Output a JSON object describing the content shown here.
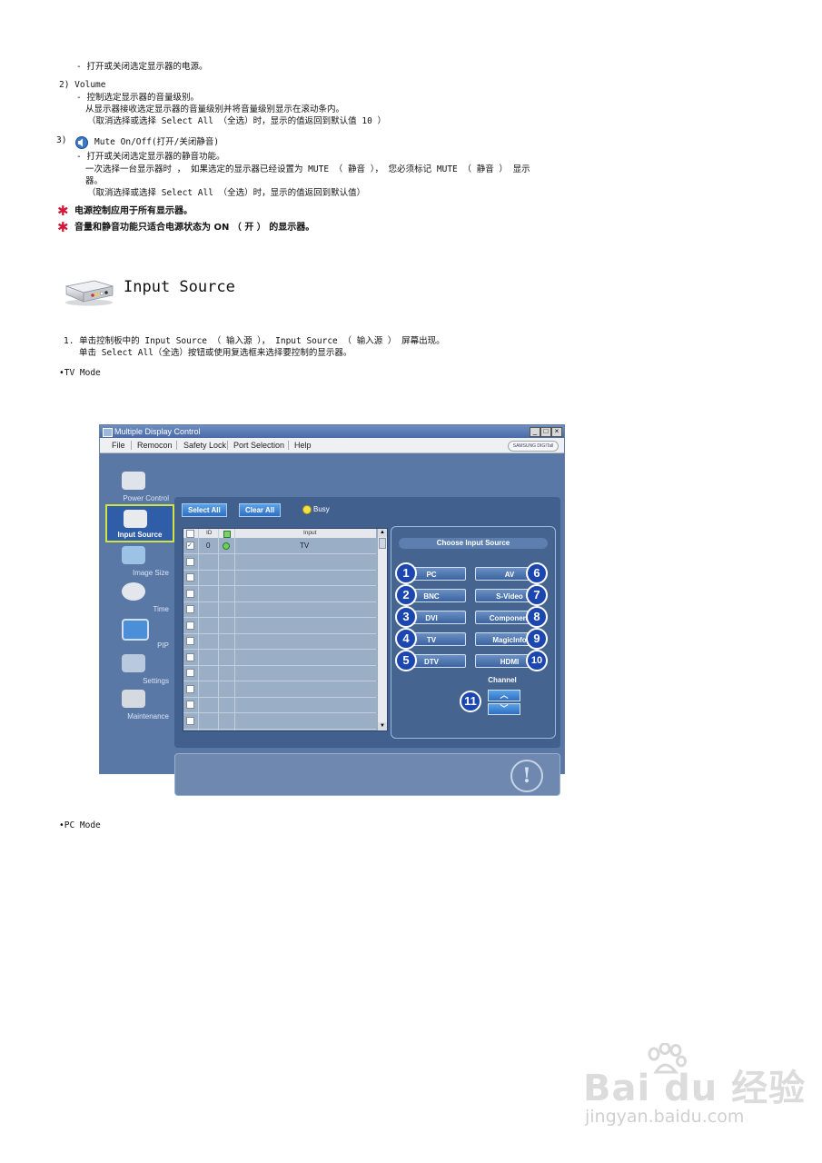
{
  "doc": {
    "line1": "- 打开或关闭选定显示器的电源。",
    "vol_num": "2) Volume",
    "vol_1": "- 控制选定显示器的音量级别。",
    "vol_2": "从显示器接收选定显示器的音量级别并将音量级别显示在滚动条内。",
    "vol_3": "（取消选择或选择 Select All （全选）时，显示的值返回到默认值 10 ）",
    "mute_num": "3)",
    "mute_title": "Mute On/Off(打开/关闭静音)",
    "mute_1": "- 打开或关闭选定显示器的静音功能。",
    "mute_2": "一次选择一台显示器时 ，  如果选定的显示器已经设置为 MUTE （ 静音 ）， 您必须标记 MUTE （ 静音 ） 显示",
    "mute_3": "器。",
    "mute_4": "（取消选择或选择 Select All （全选）时，显示的值返回到默认值）",
    "note_1": "电源控制应用于所有显示器。",
    "note_2": "音量和静音功能只适合电源状态为 ON （ 开 ） 的显示器。",
    "section_title": "Input Source",
    "step_1a": "1. 单击控制板中的 Input Source （ 输入源 ）， Input Source （ 输入源 ） 屏幕出现。",
    "step_1b": "单击 Select All（全选）按钮或使用复选框来选择要控制的显示器。",
    "tv_mode": "•TV Mode",
    "pc_mode": "•PC Mode"
  },
  "app": {
    "title": "Multiple Display Control",
    "menu": [
      "File",
      "Remocon",
      "Safety Lock",
      "Port Selection",
      "Help"
    ],
    "brand": "SAMSUNG DIGITall",
    "nav": [
      {
        "label": "Power Control",
        "icon": "power-control-icon"
      },
      {
        "label": "Input Source",
        "icon": "input-source-icon",
        "selected": true
      },
      {
        "label": "Image Size",
        "icon": "image-size-icon"
      },
      {
        "label": "Time",
        "icon": "time-icon"
      },
      {
        "label": "PIP",
        "icon": "pip-icon"
      },
      {
        "label": "Settings",
        "icon": "settings-icon"
      },
      {
        "label": "Maintenance",
        "icon": "maintenance-icon"
      }
    ],
    "select_all": "Select All",
    "clear_all": "Clear All",
    "busy": "Busy",
    "grid_headers": {
      "id": "ID",
      "input": "Input"
    },
    "grid_row1": {
      "id": "0",
      "input": "TV"
    },
    "choose_title": "Choose Input Source",
    "sources_left": [
      {
        "num": "1",
        "label": "PC"
      },
      {
        "num": "2",
        "label": "BNC"
      },
      {
        "num": "3",
        "label": "DVI"
      },
      {
        "num": "4",
        "label": "TV"
      },
      {
        "num": "5",
        "label": "DTV"
      }
    ],
    "sources_right": [
      {
        "num": "6",
        "label": "AV"
      },
      {
        "num": "7",
        "label": "S-Video"
      },
      {
        "num": "8",
        "label": "Component"
      },
      {
        "num": "9",
        "label": "MagicInfo"
      },
      {
        "num": "10",
        "label": "HDMI"
      }
    ],
    "channel_num": "11",
    "channel_label": "Channel"
  },
  "watermark": {
    "brand": "Bai du 经验",
    "url": "jingyan.baidu.com"
  }
}
